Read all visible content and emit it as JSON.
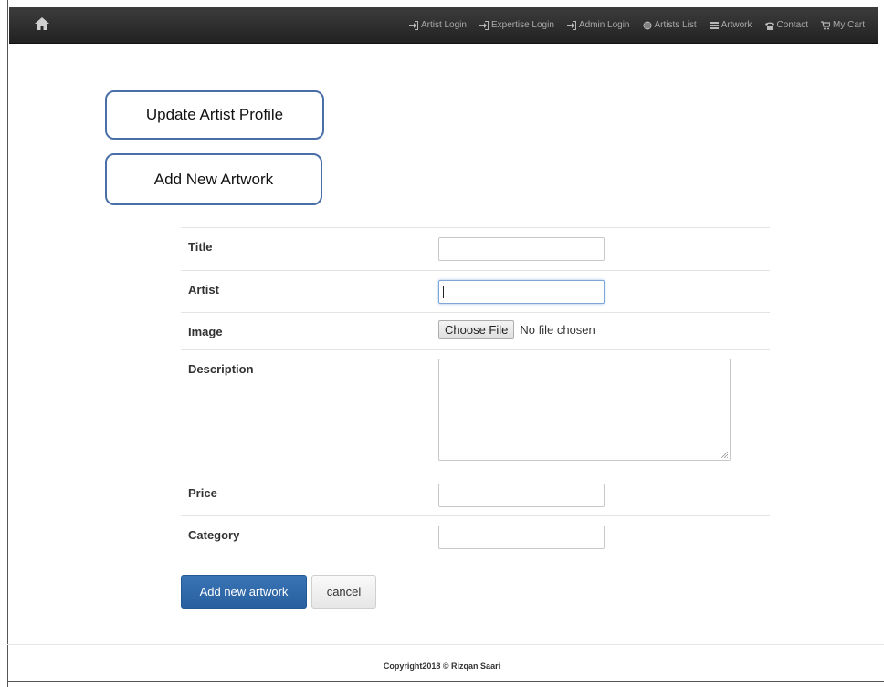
{
  "navbar": {
    "home_icon": "home-icon",
    "items": [
      {
        "label": "Artist Login",
        "icon": "login-icon"
      },
      {
        "label": "Expertise Login",
        "icon": "login-icon"
      },
      {
        "label": "Admin Login",
        "icon": "login-icon"
      },
      {
        "label": "Artists List",
        "icon": "globe-icon"
      },
      {
        "label": "Artwork",
        "icon": "list-icon"
      },
      {
        "label": "Contact",
        "icon": "phone-icon"
      },
      {
        "label": "My Cart",
        "icon": "cart-icon"
      }
    ]
  },
  "callouts": {
    "update_profile": "Update Artist Profile",
    "add_artwork": "Add New Artwork"
  },
  "form": {
    "title_label": "Title",
    "title_value": "",
    "artist_label": "Artist",
    "artist_value": "",
    "image_label": "Image",
    "choose_file": "Choose File",
    "no_file": "No file chosen",
    "description_label": "Description",
    "description_value": "",
    "price_label": "Price",
    "price_value": "",
    "category_label": "Category",
    "category_value": ""
  },
  "buttons": {
    "submit": "Add new artwork",
    "cancel": "cancel"
  },
  "footer": {
    "text": "Copyright2018 © Rizqan Saari"
  },
  "colors": {
    "navbar": "#2a2a2a",
    "primary": "#2f6aa8",
    "callout_border": "#4a6ea8"
  }
}
